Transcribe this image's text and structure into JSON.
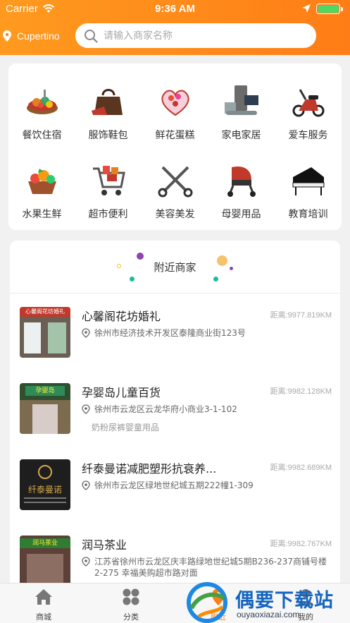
{
  "status_bar": {
    "carrier": "Carrier",
    "time": "9:36 AM"
  },
  "header": {
    "city": "Cupertino",
    "search_placeholder": "请输入商家名称",
    "accent_color": "#ff8a1b"
  },
  "categories": [
    {
      "label": "餐饮住宿",
      "icon": "food-icon"
    },
    {
      "label": "服饰鞋包",
      "icon": "handbag-icon"
    },
    {
      "label": "鲜花蛋糕",
      "icon": "cake-icon"
    },
    {
      "label": "家电家居",
      "icon": "appliance-icon"
    },
    {
      "label": "爱车服务",
      "icon": "scooter-icon"
    },
    {
      "label": "水果生鲜",
      "icon": "fruit-icon"
    },
    {
      "label": "超市便利",
      "icon": "shopping-cart-icon"
    },
    {
      "label": "美容美发",
      "icon": "scissors-icon"
    },
    {
      "label": "母婴用品",
      "icon": "stroller-icon"
    },
    {
      "label": "教育培训",
      "icon": "piano-icon"
    }
  ],
  "nearby": {
    "title": "附近商家",
    "shops": [
      {
        "name": "心馨阁花坊婚礼",
        "distance": "距离:9977.819KM",
        "address": "徐州市经济技术开发区泰隆商业街123号",
        "tag": "",
        "thumb_text": "心馨阁花坊婚礼"
      },
      {
        "name": "孕婴岛儿童百货",
        "distance": "距离:9982.128KM",
        "address": "徐州市云龙区云龙华府小商业3-1-102",
        "tag": "奶粉尿裤婴童用品",
        "thumb_text": "孕婴岛"
      },
      {
        "name": "纤泰曼诺减肥塑形抗衰养...",
        "distance": "距离:9982.689KM",
        "address": "徐州市云龙区绿地世纪城五期222幢1-309",
        "tag": "",
        "thumb_text": "纤泰曼诺"
      },
      {
        "name": "润马茶业",
        "distance": "距离:9982.767KM",
        "address": "江苏省徐州市云龙区庆丰路绿地世纪城5期B236-237商铺号楼2-275 幸福美购超市路对面",
        "tag": "",
        "thumb_text": "润马茶业"
      }
    ]
  },
  "tabbar": {
    "tabs": [
      {
        "label": "商城",
        "icon": "home-icon"
      },
      {
        "label": "分类",
        "icon": "grid-icon"
      },
      {
        "label": "附近",
        "icon": "location-icon"
      },
      {
        "label": "我的",
        "icon": "user-icon"
      }
    ]
  },
  "watermark": {
    "text": "偶要下载站",
    "url": "ouyaoxiazai.com"
  }
}
